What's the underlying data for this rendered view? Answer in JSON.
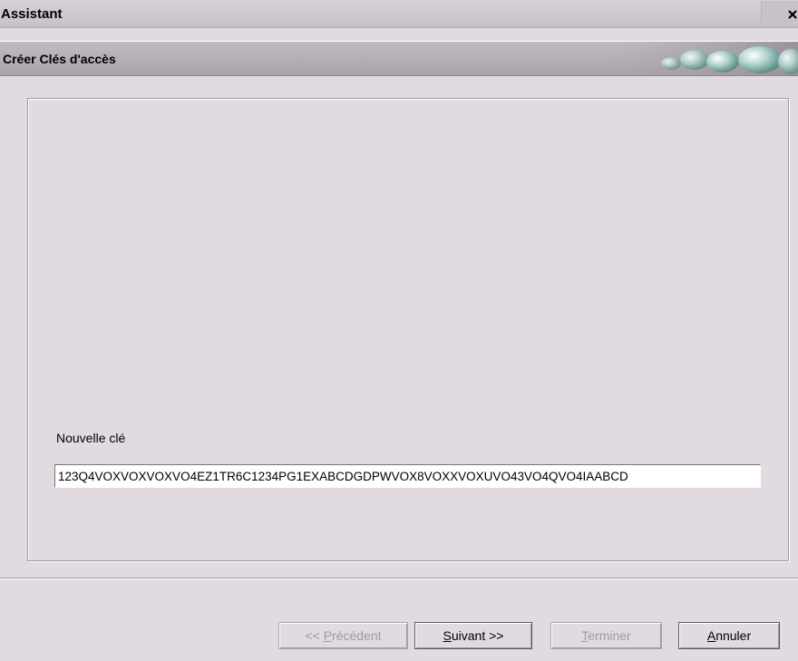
{
  "window": {
    "title": "Assistant",
    "close_glyph": "×"
  },
  "header": {
    "title": "Créer Clés d'accès",
    "logo_icon": "bubbles-logo-icon"
  },
  "form": {
    "key_label": "Nouvelle clé",
    "key_value": "123Q4VOXVOXVOXVO4EZ1TR6C1234PG1EXABCDGDPWVOX8VOXXVOXUVO43VO4QVO4IAABCD"
  },
  "buttons": {
    "previous": {
      "prefix": "<< ",
      "mnemonic": "P",
      "rest": "récédent",
      "enabled": false
    },
    "next": {
      "mnemonic": "S",
      "rest": "uivant >>",
      "enabled": true
    },
    "finish": {
      "mnemonic": "T",
      "rest": "erminer",
      "enabled": false
    },
    "cancel": {
      "mnemonic": "A",
      "rest": "nnuler",
      "enabled": true
    }
  },
  "colors": {
    "background": "#e1dbe1",
    "disabled_text": "#9f9a9f"
  }
}
